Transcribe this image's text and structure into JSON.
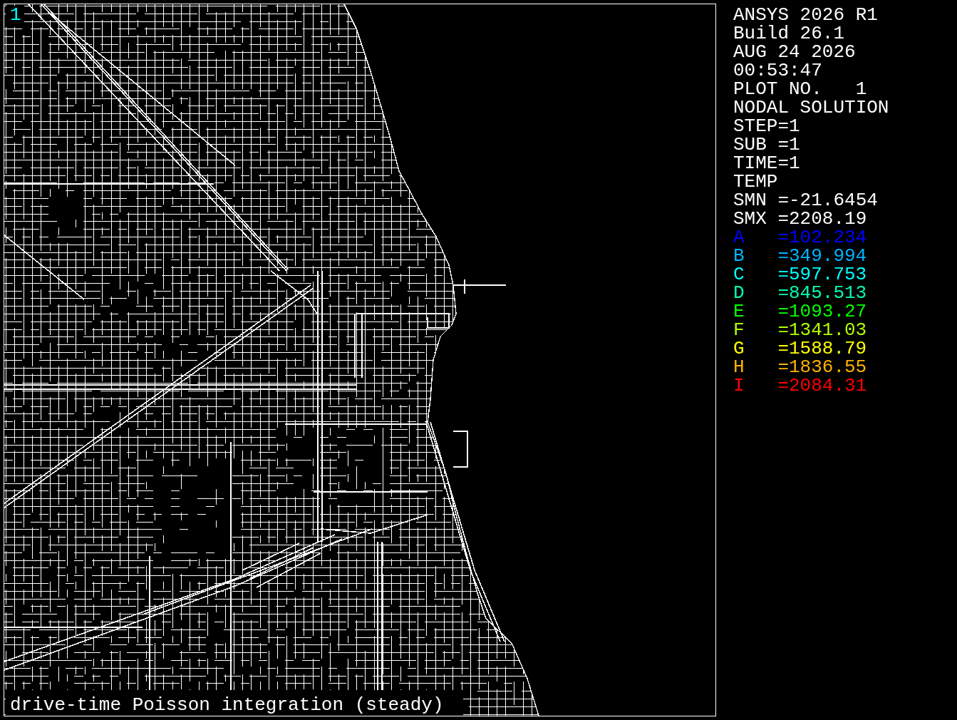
{
  "window_number": "1",
  "info_lines": [
    "ANSYS 2026 R1",
    "Build 26.1",
    "AUG 24 2026",
    "00:53:47",
    "PLOT NO.   1",
    "NODAL SOLUTION",
    "STEP=1",
    "SUB =1",
    "TIME=1",
    "TEMP",
    "SMN =-21.6454",
    "SMX =2208.19"
  ],
  "contours": [
    {
      "label": "A",
      "value": "=102.234",
      "color": "#0000ff"
    },
    {
      "label": "B",
      "value": "=349.994",
      "color": "#00b2ff"
    },
    {
      "label": "C",
      "value": "=597.753",
      "color": "#00ffff"
    },
    {
      "label": "D",
      "value": "=845.513",
      "color": "#00ffb2"
    },
    {
      "label": "E",
      "value": "=1093.27",
      "color": "#00ff00"
    },
    {
      "label": "F",
      "value": "=1341.03",
      "color": "#b2ff00"
    },
    {
      "label": "G",
      "value": "=1588.79",
      "color": "#ffff00"
    },
    {
      "label": "H",
      "value": "=1836.55",
      "color": "#ffb200"
    },
    {
      "label": "I",
      "value": "=2084.31",
      "color": "#ff0000"
    }
  ],
  "caption": "drive-time Poisson integration (steady)"
}
